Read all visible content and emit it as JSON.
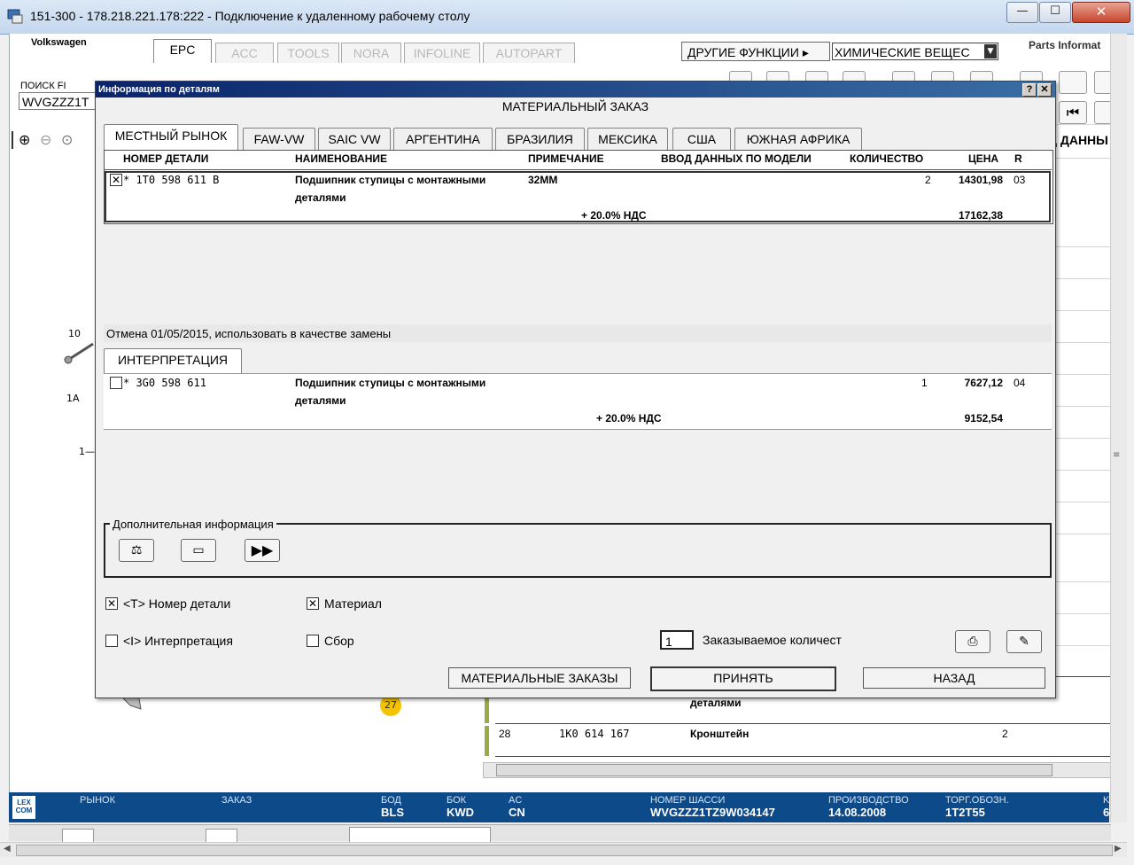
{
  "rdp": {
    "title": "151-300 - 178.218.221.178:222 - Подключение к удаленному рабочему столу",
    "minimize": "—",
    "restore": "☐",
    "close": "✕"
  },
  "app": {
    "brand": "Volkswagen",
    "brand_right": "Parts Informat",
    "tabs": [
      "EPC",
      "ACC",
      "TOOLS",
      "NORA",
      "INFOLINE",
      "AUTOPART"
    ],
    "other_functions": "ДРУГИЕ ФУНКЦИИ ▸",
    "chemicals": "ХИМИЧЕСКИЕ ВЕЩЕС",
    "search_label": "ПОИСК FI",
    "search_value": "WVGZZZ1T",
    "right_col_label": "Д ДАННЫ",
    "bg_labels": {
      "n10": "10",
      "n1a": "1A",
      "n1": "1—",
      "badge": "27"
    },
    "bg_rows": [
      {
        "text": "деталями"
      },
      {
        "pos": "28",
        "part": "1K0 614 167",
        "name": "Кронштейн",
        "qty": "2"
      }
    ]
  },
  "status": {
    "market_label": "РЫНОК",
    "order_label": "ЗАКАЗ",
    "bod_label": "БОД",
    "bod": "BLS",
    "bok_label": "БОК",
    "bok": "KWD",
    "ac_label": "AC",
    "ac": "CN",
    "chassis_label": "НОМЕР ШАССИ",
    "chassis": "WVGZZZ1TZ9W034147",
    "prod_label": "ПРОИЗВОДСТВО",
    "prod": "14.08.2008",
    "trade_label": "ТОРГ.ОБОЗН.",
    "trade": "1T2T55",
    "lexcom": "LEX COM",
    "k_label": "K",
    "k": "6"
  },
  "dialog": {
    "title": "Информация по деталям",
    "help": "?",
    "close": "✕",
    "heading": "МАТЕРИАЛЬНЫЙ ЗАКАЗ",
    "tabs": [
      "МЕСТНЫЙ РЫНОК",
      "FAW-VW",
      "SAIC VW",
      "АРГЕНТИНА",
      "БРАЗИЛИЯ",
      "МЕКСИКА",
      "США",
      "ЮЖНАЯ АФРИКА"
    ],
    "columns": {
      "part": "НОМЕР ДЕТАЛИ",
      "name": "НАИМЕНОВАНИЕ",
      "note": "ПРИМЕЧАНИЕ",
      "model": "ВВОД ДАННЫХ ПО МОДЕЛИ",
      "qty": "КОЛИЧЕСТВО",
      "price": "ЦЕНА",
      "r": "R"
    },
    "row1": {
      "check": "✕",
      "part": "* 1T0 598 611 B",
      "name1": "Подшипник ступицы с монтажными",
      "name2": "деталями",
      "note": "32MM",
      "qty": "2",
      "price": "14301,98",
      "r": "03",
      "vat": "+ 20.0% НДС",
      "price_vat": "17162,38"
    },
    "cancel_note": "Отмена 01/05/2015, использовать в качестве замены",
    "interp_tab": "ИНТЕРПРЕТАЦИЯ",
    "row2": {
      "check": "",
      "part": "* 3G0 598 611",
      "name1": "Подшипник ступицы с монтажными",
      "name2": "деталями",
      "qty": "1",
      "price": "7627,12",
      "r": "04",
      "vat": "+ 20.0% НДС",
      "price_vat": "9152,54"
    },
    "addinfo_label": "Дополнительная информация",
    "opt_part": {
      "checked": "✕",
      "label": "<T> Номер детали"
    },
    "opt_material": {
      "checked": "✕",
      "label": "Материал"
    },
    "opt_interp": {
      "checked": "",
      "label": "<I> Интерпретация"
    },
    "opt_assembly": {
      "checked": "",
      "label": "Сбор"
    },
    "order_qty_value": "1",
    "order_qty_label": "Заказываемое количест",
    "btn_orders": "МАТЕРИАЛЬНЫЕ ЗАКАЗЫ",
    "btn_accept": "ПРИНЯТЬ",
    "btn_back": "НАЗАД"
  }
}
